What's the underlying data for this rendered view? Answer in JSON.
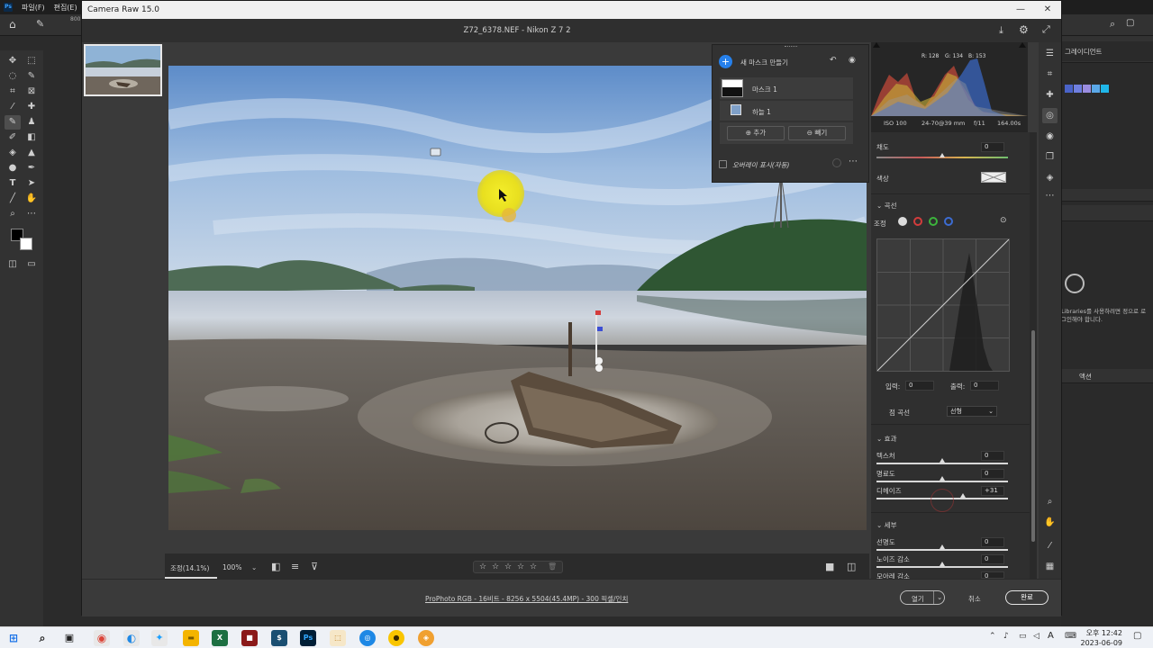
{
  "photoshop": {
    "menu": [
      "파일(F)",
      "편집(E)"
    ],
    "brush_size": "800",
    "right_panel": {
      "tab_gradient": "그레이디언트",
      "libraries_text": "Libraries를 사용하려면 정으로 로그인해야 합니다.",
      "actions_tab": "액션"
    }
  },
  "window": {
    "title": "Camera Raw 15.0",
    "file_title": "Z72_6378.NEF  -  Nikon Z 7 2"
  },
  "masks": {
    "create_label": "새 마스크 만들기",
    "items": [
      {
        "name": "마스크 1"
      },
      {
        "name": "하늘 1"
      }
    ],
    "add_label": "추가",
    "subtract_label": "빼기",
    "overlay_label": "오버레이 표시(자동)"
  },
  "histogram": {
    "r": "R: 128",
    "g": "G: 134",
    "b": "B: 153"
  },
  "exif": {
    "iso": "ISO 100",
    "lens": "24-70@39 mm",
    "aperture": "f/11",
    "shutter": "164.00s"
  },
  "adjust": {
    "saturation": {
      "label": "채도",
      "value": "0",
      "fraction": 0.5
    },
    "color_label": "색상"
  },
  "curve": {
    "section": "곡선",
    "adjust_label": "조정",
    "input_label": "입력:",
    "input_value": "0",
    "output_label": "출력:",
    "output_value": "0",
    "point_curve_label": "점 곡선",
    "point_curve_value": "선형"
  },
  "effects": {
    "section": "효과",
    "sliders": [
      {
        "label": "텍스처",
        "value": "0",
        "fraction": 0.5
      },
      {
        "label": "명료도",
        "value": "0",
        "fraction": 0.5
      },
      {
        "label": "디헤이즈",
        "value": "+31",
        "fraction": 0.655
      }
    ]
  },
  "detail": {
    "section": "세부",
    "sliders": [
      {
        "label": "선명도",
        "value": "0",
        "fraction": 0.5
      },
      {
        "label": "노이즈 감소",
        "value": "0",
        "fraction": 0.5
      },
      {
        "label": "모아레 감소",
        "value": "0",
        "fraction": 0.5
      }
    ]
  },
  "bottombar": {
    "zoom_fit": "조정(14.1%)",
    "zoom_100": "100%",
    "stars": [
      "☆",
      "☆",
      "☆",
      "☆",
      "☆"
    ]
  },
  "footer": {
    "file_info": "ProPhoto RGB - 16비트 - 8256 x 5504(45.4MP) - 300 픽셀/인치",
    "open_label": "열기",
    "cancel_label": "취소",
    "done_label": "완료"
  },
  "taskbar": {
    "time_line1": "오후 12:42",
    "time_line2": "2023-06-09",
    "ime": "A"
  }
}
